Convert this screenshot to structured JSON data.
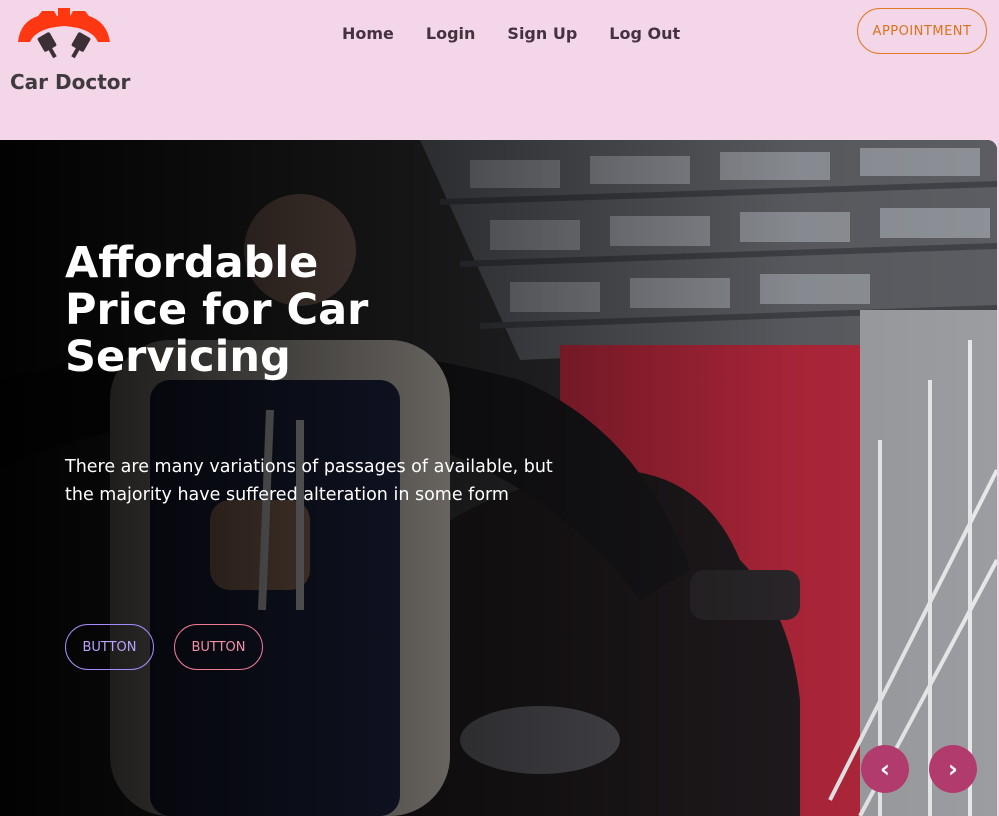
{
  "brand": {
    "name": "Car Doctor"
  },
  "nav": {
    "items": [
      "Home",
      "Login",
      "Sign Up",
      "Log Out"
    ]
  },
  "appointment": {
    "label": "APPOINTMENT"
  },
  "hero": {
    "title_lines": [
      "Affordable",
      "Price for Car",
      "Servicing"
    ],
    "description_lines": [
      "There are many variations of passages of available, but",
      "the majority have suffered alteration in some form"
    ],
    "buttons": [
      "BUTTON",
      "BUTTON"
    ],
    "prev_label": "‹",
    "next_label": "›"
  },
  "colors": {
    "page_background": "#f3d6e8",
    "logo_gear": "#ff3811",
    "appointment_accent": "#d9731d",
    "carousel_arrow": "#b23b6d",
    "hero_button_1": "#a78bfa",
    "hero_button_2": "#f07a94"
  },
  "icons": {
    "logo": "gear-pistons-icon"
  }
}
